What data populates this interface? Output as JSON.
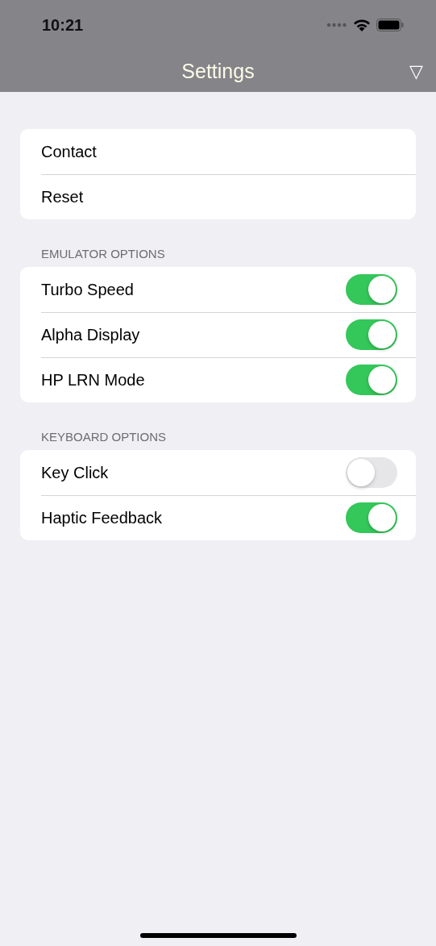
{
  "status_bar": {
    "time": "10:21"
  },
  "nav_bar": {
    "title": "Settings",
    "action": "▽"
  },
  "groups": [
    {
      "items": [
        {
          "kind": "link",
          "label": "Contact"
        },
        {
          "kind": "link",
          "label": "Reset"
        }
      ]
    },
    {
      "header": "EMULATOR OPTIONS",
      "items": [
        {
          "kind": "toggle",
          "label": "Turbo Speed",
          "on": true
        },
        {
          "kind": "toggle",
          "label": "Alpha Display",
          "on": true
        },
        {
          "kind": "toggle",
          "label": "HP LRN Mode",
          "on": true
        }
      ]
    },
    {
      "header": "KEYBOARD OPTIONS",
      "items": [
        {
          "kind": "toggle",
          "label": "Key Click",
          "on": false
        },
        {
          "kind": "toggle",
          "label": "Haptic Feedback",
          "on": true
        }
      ]
    }
  ]
}
